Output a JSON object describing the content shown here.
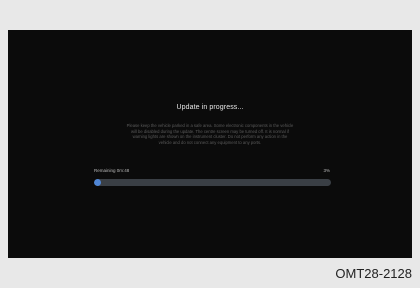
{
  "screen": {
    "title": "Update in progress...",
    "description": "Please keep the vehicle parked in a safe area. Some electronic components in the vehicle will be disabled during the update. The centre screen may be turned off. It is normal if warning lights are shown on the instrument cluster. Do not perform any action in the vehicle and do not connect any equipment to any ports.",
    "remaining_label": "Remaining 0m:48",
    "progress_text": "3%",
    "progress_value": 0.03
  },
  "figure_code": "OMT28-2128"
}
